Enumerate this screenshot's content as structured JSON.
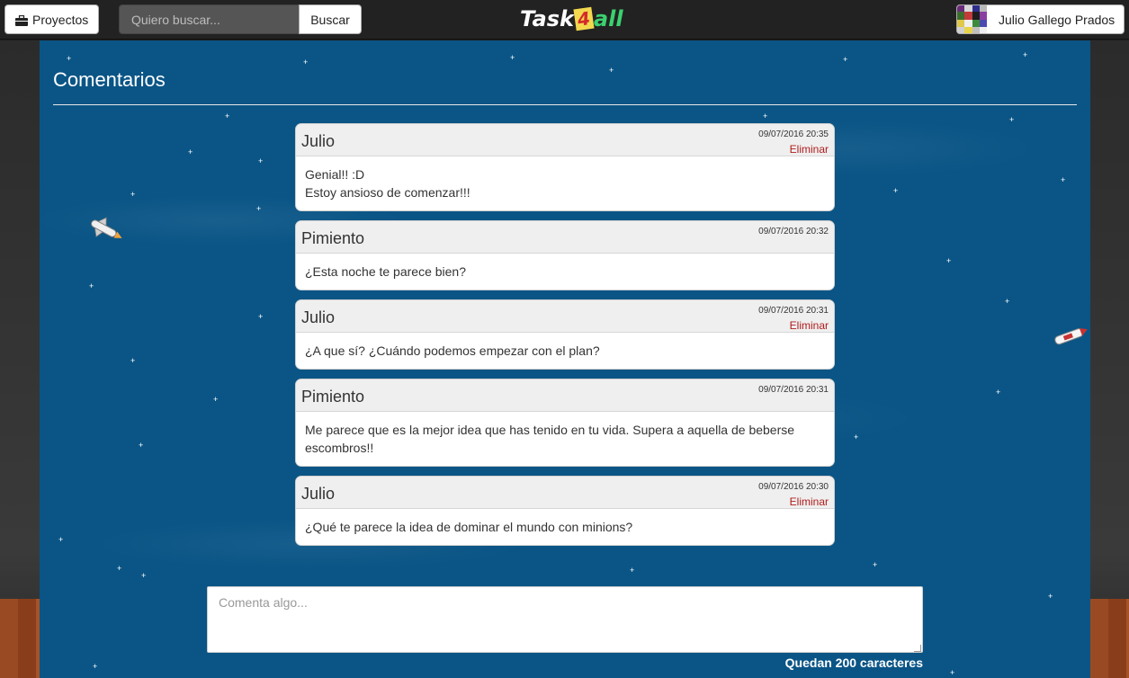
{
  "navbar": {
    "projects_label": "Proyectos",
    "search_placeholder": "Quiero buscar...",
    "search_button": "Buscar",
    "logo": {
      "task": "Task",
      "four": "4",
      "all": "all"
    },
    "user_name": "Julio Gallego Prados"
  },
  "page": {
    "title": "Comentarios"
  },
  "comments": [
    {
      "author": "Julio",
      "date": "09/07/2016 20:35",
      "delete": "Eliminar",
      "lines": [
        "Genial!! :D",
        "Estoy ansioso de comenzar!!!"
      ]
    },
    {
      "author": "Pimiento",
      "date": "09/07/2016 20:32",
      "lines": [
        "¿Esta noche te parece bien?"
      ]
    },
    {
      "author": "Julio",
      "date": "09/07/2016 20:31",
      "delete": "Eliminar",
      "lines": [
        "¿A que sí? ¿Cuándo podemos empezar con el plan?"
      ]
    },
    {
      "author": "Pimiento",
      "date": "09/07/2016 20:31",
      "lines": [
        "Me parece que es la mejor idea que has tenido en tu vida. Supera a aquella de beberse escombros!!"
      ]
    },
    {
      "author": "Julio",
      "date": "09/07/2016 20:30",
      "delete": "Eliminar",
      "lines": [
        "¿Qué te parece la idea de dominar el mundo con minions?"
      ]
    }
  ],
  "comment_form": {
    "placeholder": "Comenta algo...",
    "char_count": "Quedan 200 caracteres"
  },
  "colors": {
    "space": "#0a5586",
    "delete_link": "#b01c1c",
    "navbar": "#222222"
  }
}
